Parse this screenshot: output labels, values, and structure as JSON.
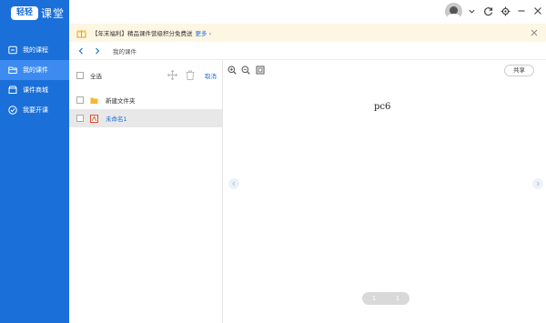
{
  "app": {
    "logo_mark": "轻轻",
    "logo_text": "课堂"
  },
  "sidebar": {
    "items": [
      {
        "label": "我的课程",
        "icon": "course-icon",
        "active": false
      },
      {
        "label": "我的课件",
        "icon": "folder-icon",
        "active": true
      },
      {
        "label": "课件商城",
        "icon": "store-icon",
        "active": false
      },
      {
        "label": "我要开课",
        "icon": "check-circle-icon",
        "active": false
      }
    ]
  },
  "notice": {
    "text": "【年末福利】精品课件营级积分免费送",
    "more": "更多"
  },
  "breadcrumb": {
    "current": "我的课件"
  },
  "files": {
    "select_all": "全选",
    "cancel": "取消",
    "items": [
      {
        "name": "新建文件夹",
        "type": "folder"
      },
      {
        "name": "未命名1",
        "type": "ppt",
        "selected": true
      }
    ]
  },
  "preview": {
    "share": "共享",
    "slide_text": "pc6",
    "page_current": "1",
    "page_total": "1"
  },
  "colors": {
    "brand": "#1a6fd9",
    "sidebar_active": "#3d8bf0",
    "notice_bg": "#fdf6e3",
    "folder": "#f5b731",
    "ppt": "#e0492f"
  }
}
